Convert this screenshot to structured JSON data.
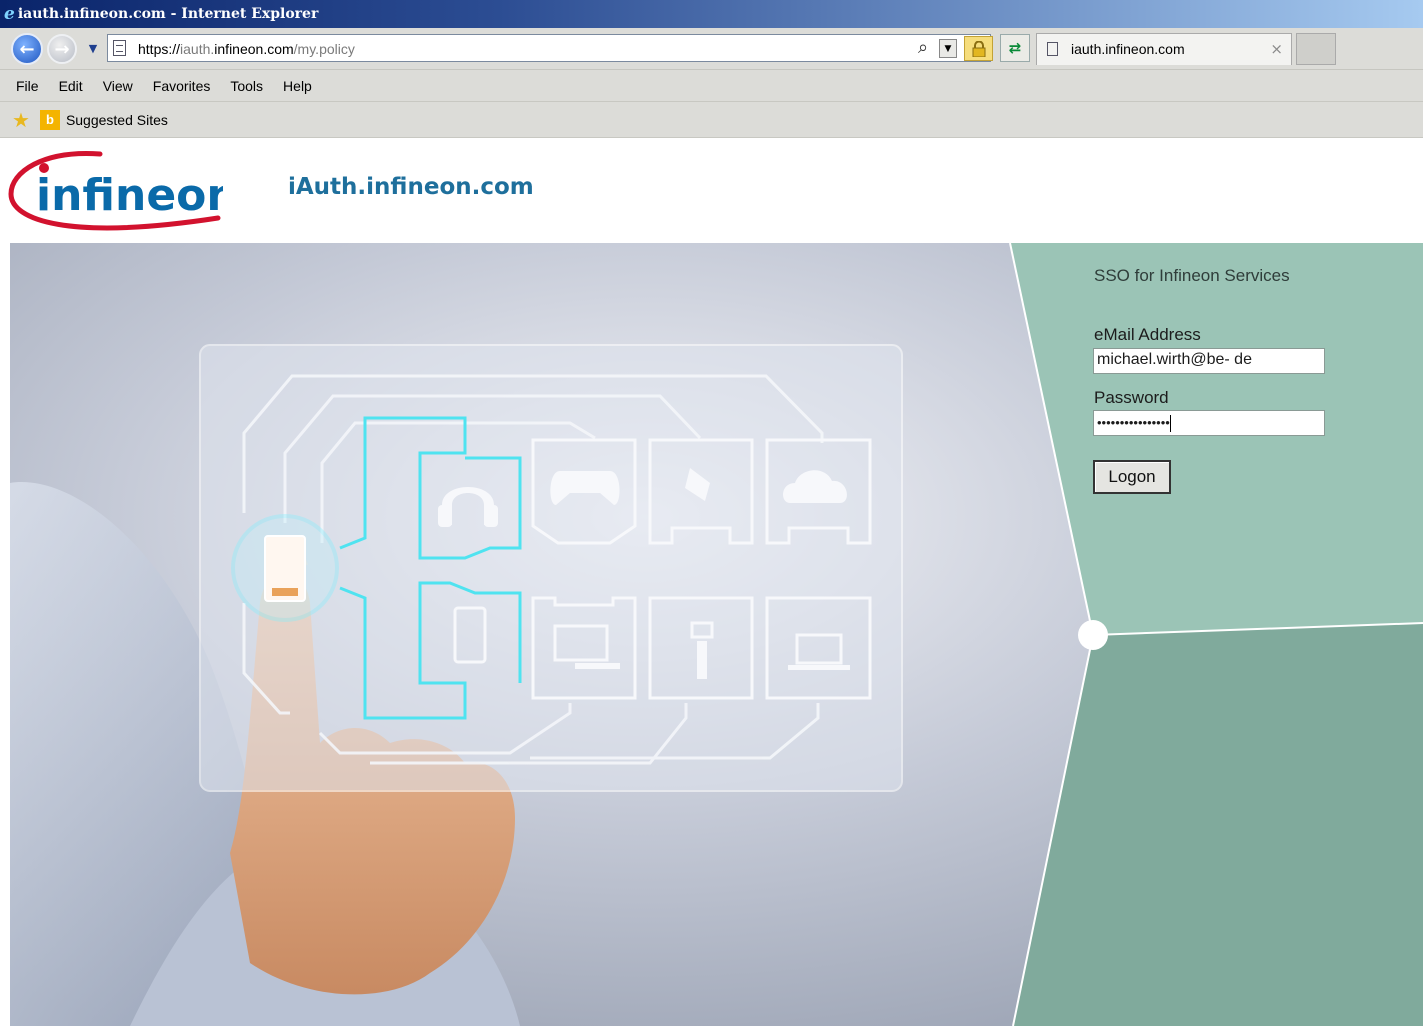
{
  "window": {
    "title": "iauth.infineon.com - Internet Explorer"
  },
  "navigation": {
    "url_scheme": "https://",
    "url_sub": "iauth.",
    "url_domain": "infineon.com",
    "url_path": "/my.policy",
    "tab_label": "iauth.infineon.com",
    "tab_close": "×"
  },
  "menu": {
    "items": [
      "File",
      "Edit",
      "View",
      "Favorites",
      "Tools",
      "Help"
    ]
  },
  "favorites": {
    "suggested_sites": "Suggested Sites"
  },
  "header": {
    "logo_text": "infineon",
    "site_title": "iAuth.infineon.com"
  },
  "login": {
    "heading": "SSO for Infineon Services",
    "email_label": "eMail Address",
    "email_value": "michael.wirth@be-               de",
    "password_label": "Password",
    "password_value": "••••••••••••••••",
    "logon_label": "Logon"
  },
  "colors": {
    "panel_top": "#9bc4b6",
    "panel_bottom": "#80aa9c",
    "title_color": "#1e6f9c",
    "logo_red": "#d2122e",
    "logo_blue": "#0a6aa9"
  }
}
